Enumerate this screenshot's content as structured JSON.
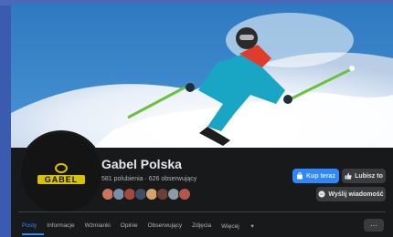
{
  "page": {
    "name": "Gabel Polska",
    "stats": "581 polubienia · 626 obserwujący",
    "logo_text": "GABEL"
  },
  "actions": {
    "shop_label": "Kup teraz",
    "like_label": "Lubisz to",
    "message_label": "Wyślij wiadomość"
  },
  "nav": {
    "items": [
      "Posty",
      "Informacje",
      "Wzmianki",
      "Opinie",
      "Obserwujący",
      "Zdjęcia",
      "Więcej"
    ],
    "more_label": "···"
  },
  "colors": {
    "accent": "#2d88ff",
    "logo_yellow": "#d9c300",
    "panel": "#18191a"
  }
}
